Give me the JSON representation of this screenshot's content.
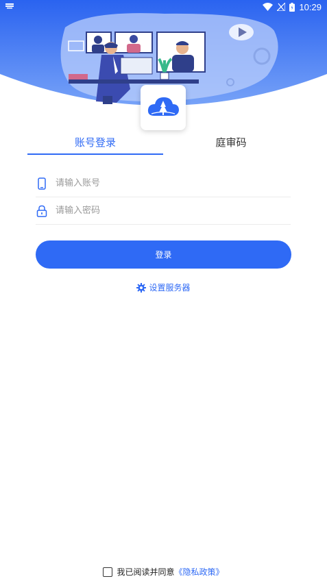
{
  "status_bar": {
    "time": "10:29"
  },
  "tabs": [
    {
      "label": "账号登录",
      "active": true
    },
    {
      "label": "庭审码",
      "active": false
    }
  ],
  "form": {
    "account_placeholder": "请输入账号",
    "password_placeholder": "请输入密码"
  },
  "login_button": "登录",
  "server_link": "设置服务器",
  "agreement": {
    "text": "我已阅读并同意",
    "policy_link": "《隐私政策》",
    "checked": false
  },
  "colors": {
    "primary": "#2f6af5",
    "header_gradient_top": "#2a63f0",
    "header_gradient_bottom": "#6e9bf8"
  },
  "icons": {
    "phone": "phone-icon",
    "lock": "lock-icon",
    "gear": "gear-icon",
    "wifi": "wifi-icon",
    "signal": "signal-icon",
    "battery": "battery-icon"
  }
}
